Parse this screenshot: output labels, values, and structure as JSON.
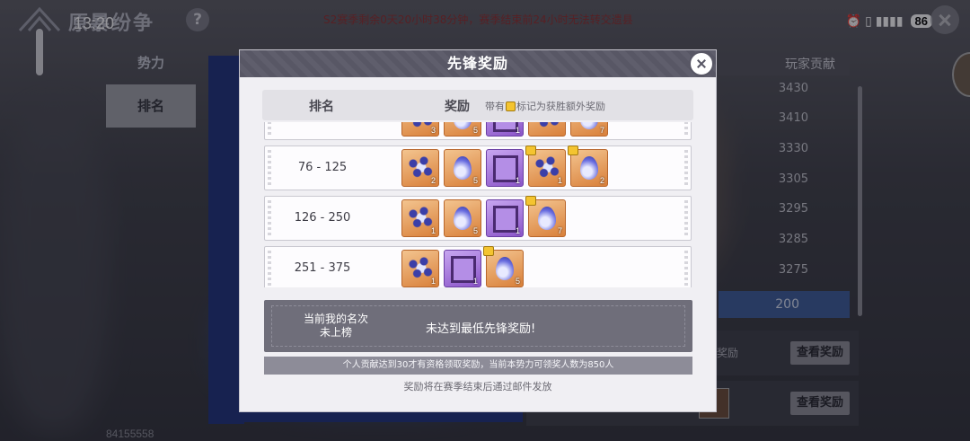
{
  "status_bar": {
    "time": "13:20",
    "battery": "86",
    "icons_text": "⏰ ▯ ▮▮▮▮"
  },
  "background": {
    "title": "原暴纷争",
    "help_label": "?",
    "season_notice": "S2赛季剩余0天20小时38分钟，赛季结束前24小时无法转交遗县",
    "side_tabs": [
      "势力",
      "排名"
    ],
    "contribution_header": "玩家贡献",
    "contribution_values": [
      "3430",
      "3410",
      "3330",
      "3305",
      "3295",
      "3285",
      "3275"
    ],
    "my_contribution": "200",
    "reward_label": "奖励",
    "view_reward_label": "查看奖励",
    "user_id": "84155558"
  },
  "modal": {
    "title": "先锋奖励",
    "header": {
      "rank": "排名",
      "reward": "奖励",
      "note_prefix": "带有",
      "note_suffix": "标记为获胜额外奖励"
    },
    "rows": [
      {
        "rank": "",
        "items": [
          {
            "type": "beads",
            "bg": "orange",
            "qty": "3"
          },
          {
            "type": "drop",
            "bg": "orange",
            "qty": "5"
          },
          {
            "type": "frame",
            "bg": "purple",
            "qty": "1"
          },
          {
            "type": "beads",
            "bg": "orange",
            "qty": "",
            "crown": true
          },
          {
            "type": "drop",
            "bg": "orange",
            "qty": "7",
            "crown": true
          }
        ]
      },
      {
        "rank": "76 - 125",
        "items": [
          {
            "type": "beads",
            "bg": "orange",
            "qty": "2"
          },
          {
            "type": "drop",
            "bg": "orange",
            "qty": "5"
          },
          {
            "type": "frame",
            "bg": "purple",
            "qty": "1"
          },
          {
            "type": "beads",
            "bg": "orange",
            "qty": "1",
            "crown": true
          },
          {
            "type": "drop",
            "bg": "orange",
            "qty": "2",
            "crown": true
          }
        ]
      },
      {
        "rank": "126 - 250",
        "items": [
          {
            "type": "beads",
            "bg": "orange",
            "qty": "1"
          },
          {
            "type": "drop",
            "bg": "orange",
            "qty": "5"
          },
          {
            "type": "frame",
            "bg": "purple",
            "qty": "1"
          },
          {
            "type": "drop",
            "bg": "orange",
            "qty": "7",
            "crown": true
          }
        ]
      },
      {
        "rank": "251 - 375",
        "items": [
          {
            "type": "beads",
            "bg": "orange",
            "qty": "1"
          },
          {
            "type": "frame",
            "bg": "purple",
            "qty": "1"
          },
          {
            "type": "drop",
            "bg": "orange",
            "qty": "5",
            "crown": true
          }
        ]
      }
    ],
    "my_rank_label_1": "当前我的名次",
    "my_rank_label_2": "未上榜",
    "my_rank_message": "未达到最低先锋奖励!",
    "requirement": "个人贡献达到30才有资格领取奖励，当前本势力可领奖人数为850人",
    "footer": "奖励将在赛季结束后通过邮件发放"
  }
}
